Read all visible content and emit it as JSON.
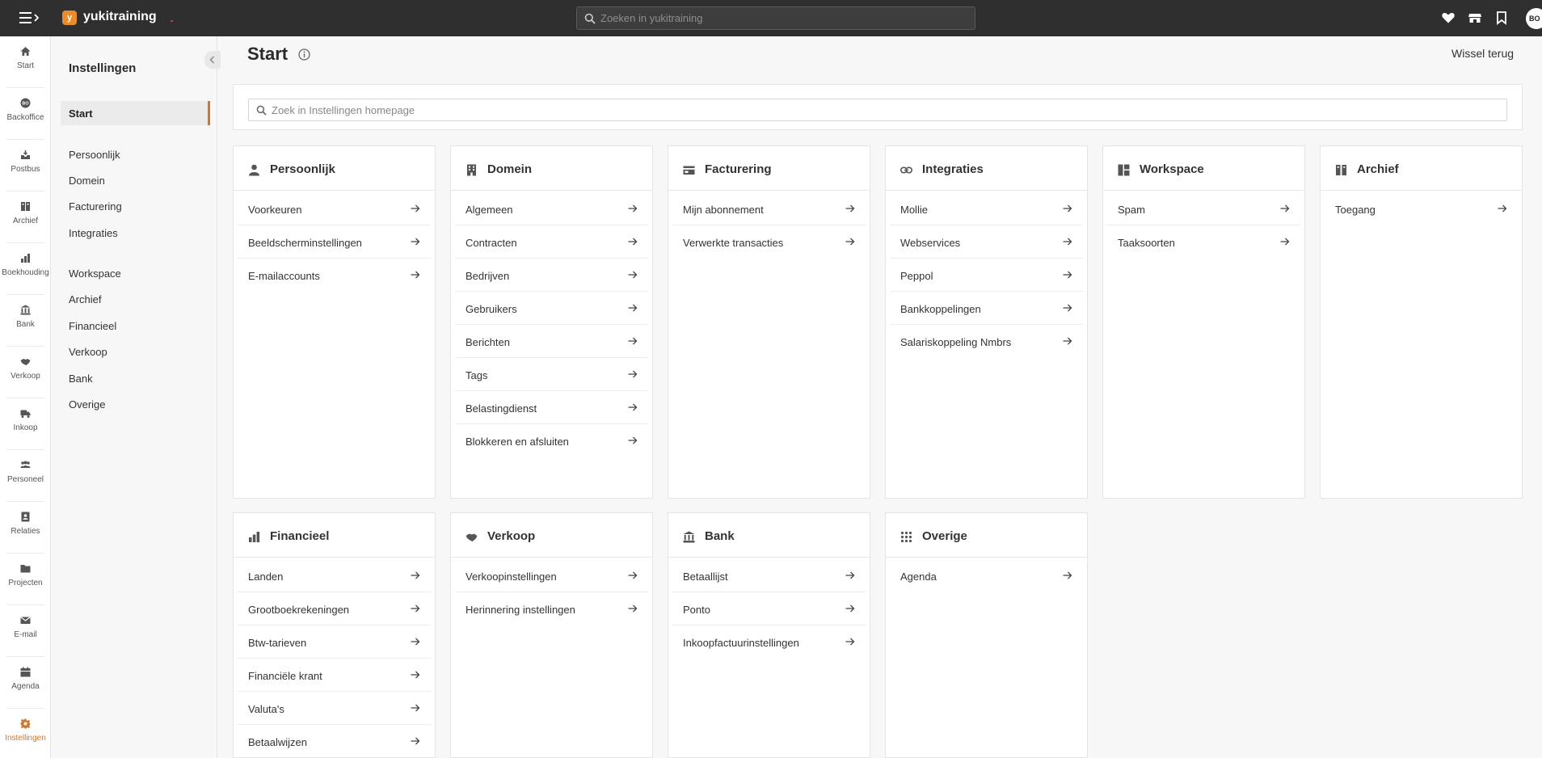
{
  "topbar": {
    "logo_letter": "y",
    "app_name": "yukitraining",
    "search_placeholder": "Zoeken in yukitraining",
    "avatar_initials": "BO",
    "icons": [
      "heart-icon",
      "store-icon",
      "bookmark-icon"
    ]
  },
  "leftnav": {
    "items": [
      {
        "label": "Start",
        "icon": "home-icon"
      },
      {
        "label": "Backoffice",
        "icon": "backoffice-icon"
      },
      {
        "label": "Postbus",
        "icon": "inbox-icon"
      },
      {
        "label": "Archief",
        "icon": "archive-icon"
      },
      {
        "label": "Boekhouding",
        "icon": "bar-chart-icon"
      },
      {
        "label": "Bank",
        "icon": "bank-icon"
      },
      {
        "label": "Verkoop",
        "icon": "handshake-icon"
      },
      {
        "label": "Inkoop",
        "icon": "truck-icon"
      },
      {
        "label": "Personeel",
        "icon": "people-icon"
      },
      {
        "label": "Relaties",
        "icon": "contacts-icon"
      },
      {
        "label": "Projecten",
        "icon": "folder-icon"
      },
      {
        "label": "E-mail",
        "icon": "mail-icon"
      },
      {
        "label": "Agenda",
        "icon": "calendar-icon"
      },
      {
        "label": "Instellingen",
        "icon": "settings-icon"
      }
    ]
  },
  "settings_panel": {
    "title": "Instellingen",
    "active": "Start",
    "group1": [
      "Persoonlijk",
      "Domein",
      "Facturering",
      "Integraties"
    ],
    "group2": [
      "Workspace",
      "Archief",
      "Financieel",
      "Verkoop",
      "Bank",
      "Overige"
    ]
  },
  "main": {
    "title": "Start",
    "switch_back": "Wissel terug",
    "search_placeholder": "Zoek in Instellingen homepage"
  },
  "cards": [
    {
      "title": "Persoonlijk",
      "icon": "person-icon",
      "items": [
        "Voorkeuren",
        "Beeldscherminstellingen",
        "E-mailaccounts"
      ]
    },
    {
      "title": "Domein",
      "icon": "building-icon",
      "items": [
        "Algemeen",
        "Contracten",
        "Bedrijven",
        "Gebruikers",
        "Berichten",
        "Tags",
        "Belastingdienst",
        "Blokkeren en afsluiten"
      ]
    },
    {
      "title": "Facturering",
      "icon": "billing-icon",
      "items": [
        "Mijn abonnement",
        "Verwerkte transacties"
      ]
    },
    {
      "title": "Integraties",
      "icon": "link-icon",
      "items": [
        "Mollie",
        "Webservices",
        "Peppol",
        "Bankkoppelingen",
        "Salariskoppeling Nmbrs"
      ]
    },
    {
      "title": "Workspace",
      "icon": "dashboard-icon",
      "items": [
        "Spam",
        "Taaksoorten"
      ]
    },
    {
      "title": "Archief",
      "icon": "archive-icon",
      "items": [
        "Toegang"
      ]
    },
    {
      "title": "Financieel",
      "icon": "bar-chart-icon",
      "items": [
        "Landen",
        "Grootboekrekeningen",
        "Btw-tarieven",
        "Financiële krant",
        "Valuta's",
        "Betaalwijzen"
      ]
    },
    {
      "title": "Verkoop",
      "icon": "handshake-icon",
      "items": [
        "Verkoopinstellingen",
        "Herinnering instellingen"
      ]
    },
    {
      "title": "Bank",
      "icon": "bank-icon",
      "items": [
        "Betaallijst",
        "Ponto",
        "Inkoopfactuurinstellingen"
      ]
    },
    {
      "title": "Overige",
      "icon": "grid-icon",
      "items": [
        "Agenda"
      ]
    }
  ],
  "colors": {
    "accent": "#d4752a",
    "topbar": "#2f2f2f",
    "brand_logo": "#e98c2b"
  }
}
